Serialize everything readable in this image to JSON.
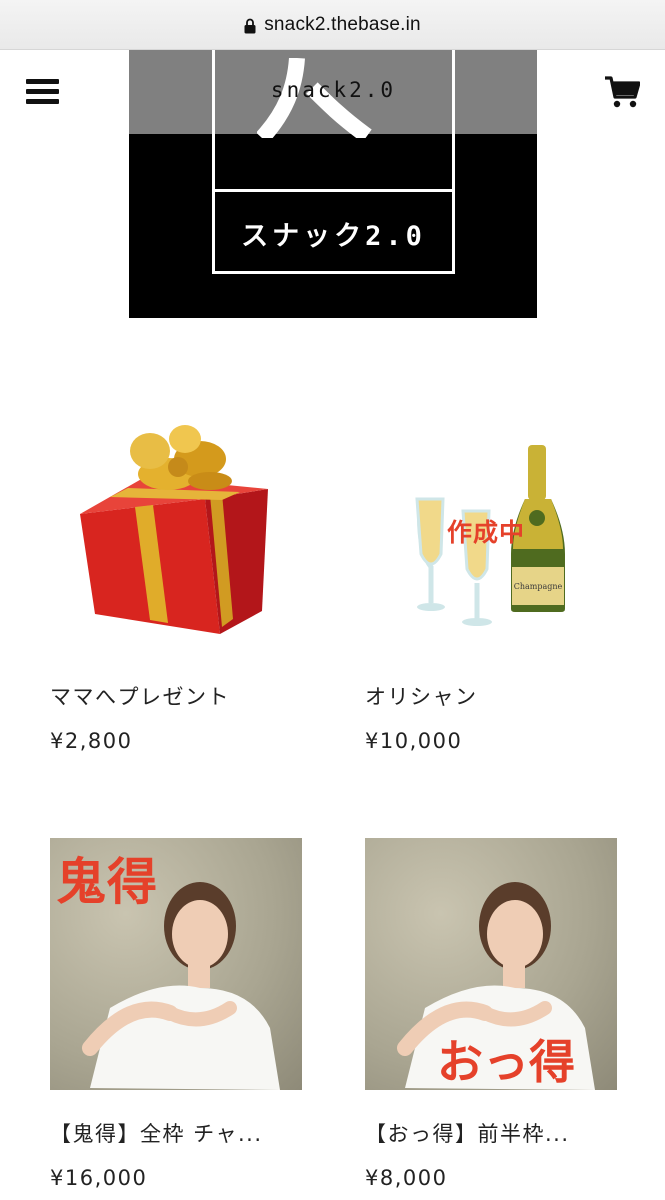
{
  "browser": {
    "url": "snack2.thebase.in"
  },
  "header": {
    "menu_icon": "hamburger-menu-icon",
    "cart_icon": "shopping-cart-icon"
  },
  "logo": {
    "top_text": "snack2.0",
    "bottom_text": "スナック2.0",
    "colors": {
      "gray": "#808080",
      "black": "#000000",
      "white": "#ffffff"
    }
  },
  "products": [
    {
      "name": "ママへプレゼント",
      "price": "¥2,800",
      "image": "red-gift-box"
    },
    {
      "name": "オリシャン",
      "price": "¥10,000",
      "image": "champagne-bottle-and-glasses",
      "overlay": "作成中"
    },
    {
      "name": "【鬼得】全枠 チャ...",
      "price": "¥16,000",
      "image": "woman-heart-pose-photo",
      "overlay": "鬼得"
    },
    {
      "name": "【おっ得】前半枠...",
      "price": "¥8,000",
      "image": "woman-heart-pose-photo",
      "overlay": "おっ得"
    }
  ],
  "accent_color": "#e5412a"
}
